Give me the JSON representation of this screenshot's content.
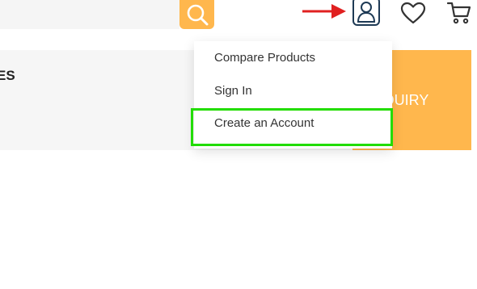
{
  "header": {
    "icons": {
      "search": "search-icon",
      "account": "user-icon",
      "wishlist": "heart-icon",
      "cart": "cart-icon"
    },
    "search_button_color": "#ffb74d"
  },
  "banner": {
    "heading": "ES",
    "enquiry_label": "NQUIRY"
  },
  "account_menu": {
    "items": [
      {
        "label": "Compare Products"
      },
      {
        "label": "Sign In"
      },
      {
        "label": "Create an Account"
      }
    ]
  },
  "annotations": {
    "arrow_color": "#e02020",
    "highlight_color": "#22dd00"
  }
}
